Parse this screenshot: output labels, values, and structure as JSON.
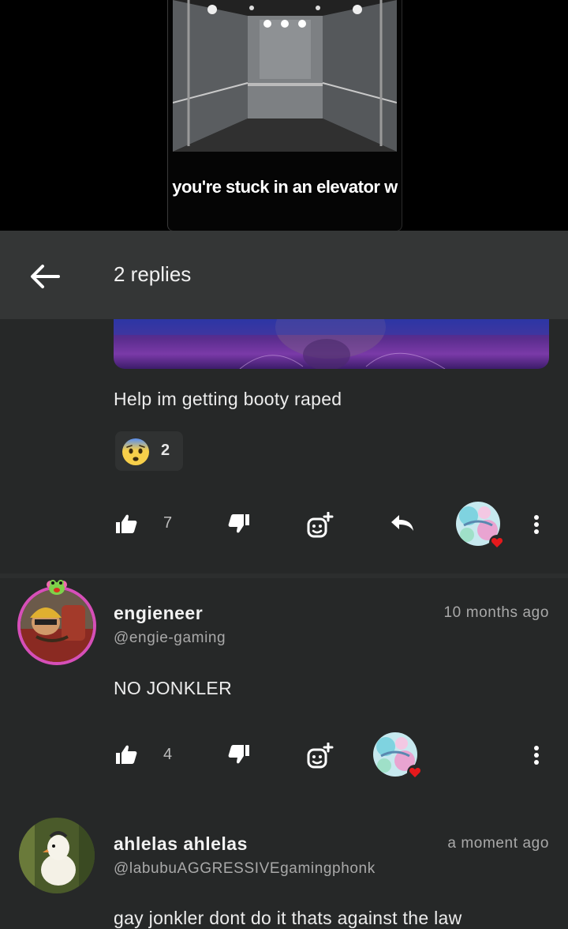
{
  "video": {
    "caption": "you're stuck in an elevator w"
  },
  "header": {
    "title": "2 replies"
  },
  "reply_1": {
    "text": "Help im getting booty raped",
    "reaction_emoji": "anxious-face",
    "reaction_count": "2",
    "likes": "7"
  },
  "reply_2": {
    "name": "engieneer",
    "handle": "@engie-gaming",
    "time": "10 months ago",
    "text": "NO JONKLER",
    "likes": "4"
  },
  "reply_3": {
    "name": "ahlelas ahlelas",
    "handle": "@labubuAGGRESSIVEgamingphonk",
    "time": "a moment ago",
    "text": "gay jonkler dont do it thats against the law"
  },
  "colors": {
    "background": "#262828",
    "header": "#343636",
    "heart": "#e5191c",
    "avatar_ring": "#d64fb8"
  }
}
